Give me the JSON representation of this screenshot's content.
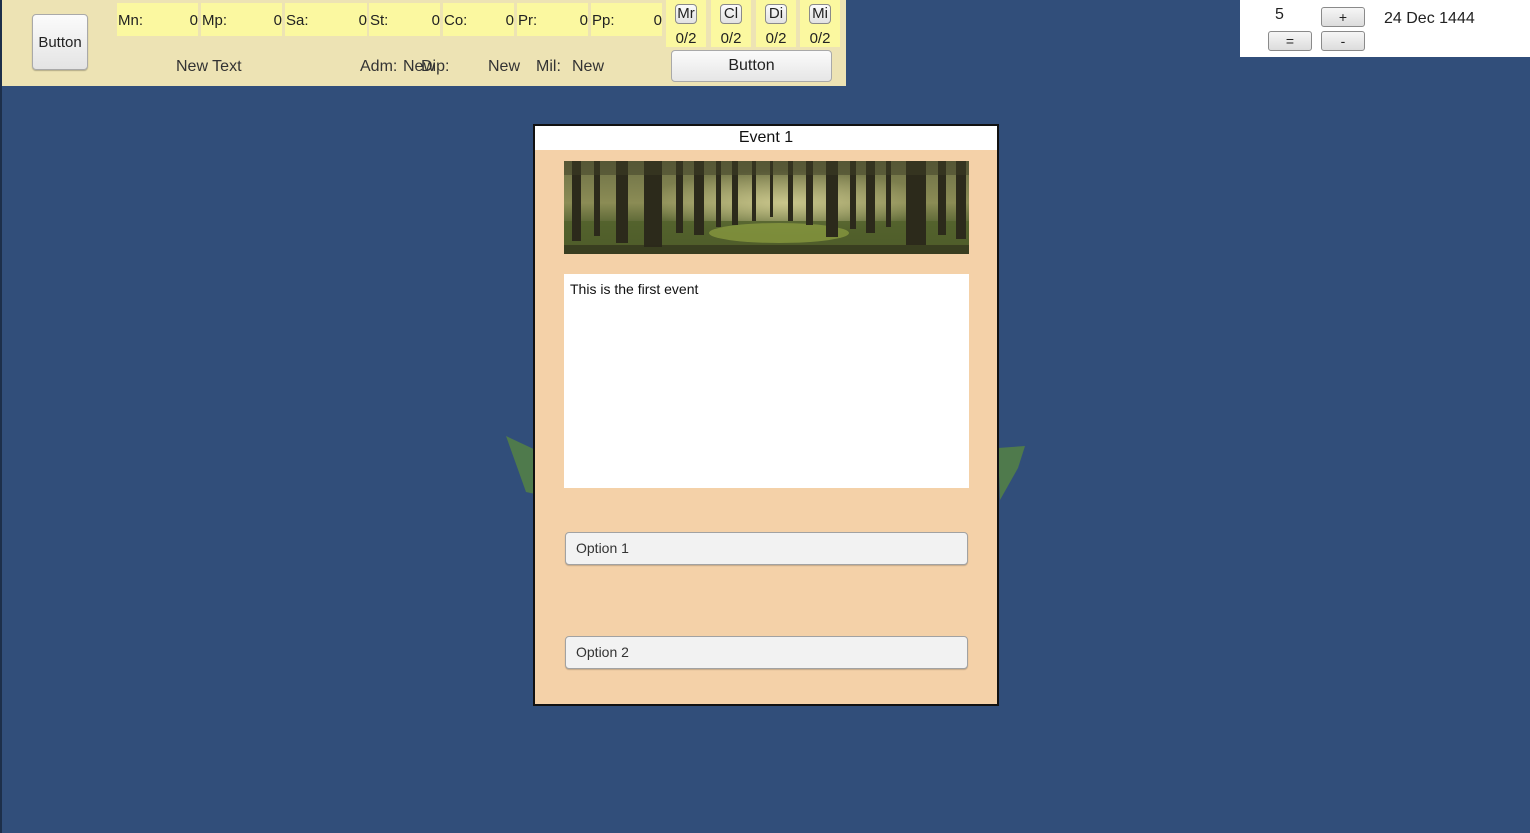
{
  "top_panel": {
    "main_button": "Button",
    "stats": [
      {
        "label": "Mn:",
        "value": "0"
      },
      {
        "label": "Mp:",
        "value": "0"
      },
      {
        "label": "Sa:",
        "value": "0"
      },
      {
        "label": "St:",
        "value": "0"
      },
      {
        "label": "Co:",
        "value": "0"
      },
      {
        "label": "Pr:",
        "value": "0"
      },
      {
        "label": "Pp:",
        "value": "0"
      }
    ],
    "mana_buttons": [
      {
        "label": "Mr",
        "value": "0/2"
      },
      {
        "label": "Cl",
        "value": "0/2"
      },
      {
        "label": "Di",
        "value": "0/2"
      },
      {
        "label": "Mi",
        "value": "0/2"
      }
    ],
    "new_text": "New Text",
    "adm": {
      "label": "Adm:",
      "value": "New"
    },
    "dip": {
      "label": "Dip:",
      "value": "New"
    },
    "mil": {
      "label": "Mil:",
      "value": "New"
    },
    "bottom_button": "Button"
  },
  "time_panel": {
    "speed": "5",
    "plus": "+",
    "equals": "=",
    "minus": "-",
    "date": "24 Dec 1444"
  },
  "event": {
    "title": "Event 1",
    "description": "This is the first event",
    "options": [
      "Option 1",
      "Option 2"
    ]
  },
  "colors": {
    "background": "#314e7a",
    "panel": "#ede3b4",
    "stat_highlight": "#fbf8a0",
    "event_bg": "#f4d1a8",
    "land": "#4f7a4c"
  }
}
